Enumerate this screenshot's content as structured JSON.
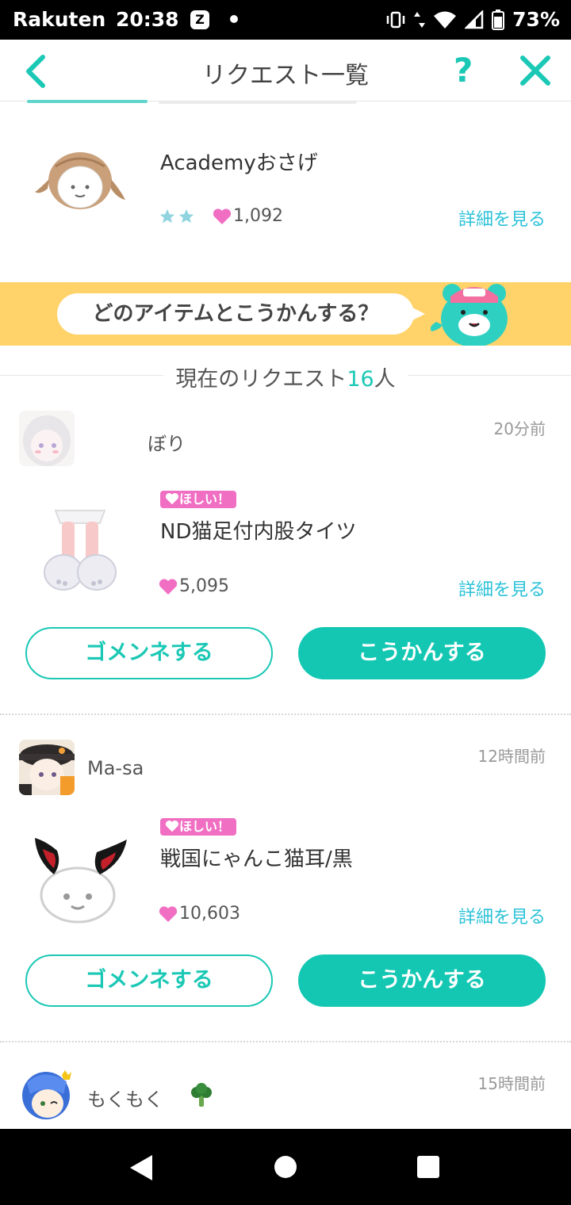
{
  "status_bar": {
    "carrier": "Rakuten",
    "time": "20:38",
    "notification_icon": "Z",
    "battery": "73%"
  },
  "header": {
    "title": "リクエスト一覧",
    "help_label": "?"
  },
  "own_item": {
    "name": "Academyおさげ",
    "likes": "1,092",
    "rarity_stars": 2,
    "detail_label": "詳細を見る"
  },
  "banner": {
    "text": "どのアイテムとこうかんする？"
  },
  "requests_header": {
    "prefix": "現在のリクエスト",
    "count": "16",
    "suffix": "人"
  },
  "requests": [
    {
      "user": "ぼり",
      "time_ago": "20分前",
      "badge": "ほしい！",
      "item_name": "ND猫足付内股タイツ",
      "likes": "5,095",
      "detail_label": "詳細を見る",
      "decline_label": "ゴメンネする",
      "exchange_label": "こうかんする"
    },
    {
      "user": "Ma-sa",
      "time_ago": "12時間前",
      "badge": "ほしい！",
      "item_name": "戦国にゃんこ猫耳/黒",
      "likes": "10,603",
      "detail_label": "詳細を見る",
      "decline_label": "ゴメンネする",
      "exchange_label": "こうかんする"
    },
    {
      "user": "もくもく",
      "time_ago": "15時間前"
    }
  ],
  "colors": {
    "accent": "#13c7b3",
    "link": "#2cc2d8",
    "banner": "#ffd36a",
    "badge": "#f06fc3",
    "heart": "#f06fc3"
  }
}
